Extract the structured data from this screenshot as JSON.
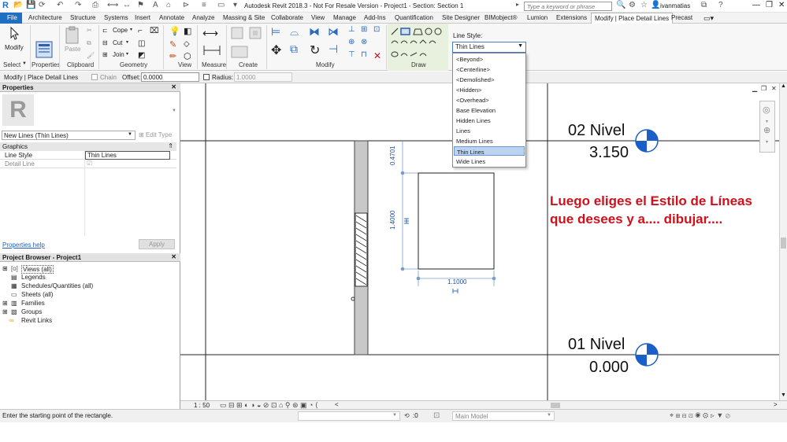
{
  "app": {
    "title": "Autodesk Revit 2018.3 - Not For Resale Version -   Project1 - Section: Section 1",
    "search_placeholder": "Type a keyword or phrase",
    "user": "ivanmatias"
  },
  "tabs": [
    "File",
    "Architecture",
    "Structure",
    "Systems",
    "Insert",
    "Annotate",
    "Analyze",
    "Massing & Site",
    "Collaborate",
    "View",
    "Manage",
    "Add-Ins",
    "Quantification",
    "Site Designer",
    "BIMobject®",
    "Lumion",
    "Extensions",
    "Modify | Place Detail Lines",
    "Precast"
  ],
  "ribbon": {
    "modify_label": "Modify",
    "select_label": "Select",
    "properties_label": "Properties",
    "paste_label": "Paste",
    "cope_label": "Cope",
    "cut_label": "Cut",
    "join_label": "Join",
    "panels": {
      "select": "Select",
      "properties": "Properties",
      "clipboard": "Clipboard",
      "geometry": "Geometry",
      "view": "View",
      "measure": "Measure",
      "create": "Create",
      "modify": "Modify",
      "draw": "Draw"
    },
    "line_style_label": "Line Style:",
    "line_style_value": "Thin Lines"
  },
  "line_style_options": [
    "<Beyond>",
    "<Centerline>",
    "<Demolished>",
    "<Hidden>",
    "<Overhead>",
    "Base Elevation",
    "Hidden Lines",
    "Lines",
    "Medium Lines",
    "Thin Lines",
    "Wide Lines"
  ],
  "selected_line_style_index": 9,
  "options_bar": {
    "context": "Modify | Place Detail Lines",
    "chain_label": "Chain",
    "offset_label": "Offset:",
    "offset_value": "0.0000",
    "radius_label": "Radius:",
    "radius_value": "1.0000"
  },
  "properties": {
    "title": "Properties",
    "type_name": "New Lines (Thin Lines)",
    "edit_type": "Edit Type",
    "group": "Graphics",
    "rows": [
      {
        "name": "Line Style",
        "value": "Thin Lines"
      },
      {
        "name": "Detail Line",
        "value": ""
      }
    ],
    "help_link": "Properties help",
    "apply": "Apply"
  },
  "project_browser": {
    "title": "Project Browser - Project1",
    "items": [
      "Views (all)",
      "Legends",
      "Schedules/Quantities (all)",
      "Sheets (all)",
      "Families",
      "Groups",
      "Revit Links"
    ]
  },
  "canvas": {
    "levels": [
      {
        "name": "02 Nivel",
        "elevation": "3.150"
      },
      {
        "name": "01 Nivel",
        "elevation": "0.000"
      }
    ],
    "dims": {
      "top": "0.4701",
      "side": "1.4000",
      "bottom": "1.1000"
    },
    "annotation_line1": "Luego eliges el Estilo de Líneas",
    "annotation_line2": "que desees y a.... dibujar...."
  },
  "view_bar": {
    "scale": "1 : 50"
  },
  "status": {
    "prompt": "Enter the starting point of the rectangle.",
    "worksets_count": ":0",
    "model": "Main Model"
  },
  "colors": {
    "file_tab": "#1f6fc2",
    "annotation": "#d0101a",
    "level_marker": "#1a5fc9",
    "draw_panel": "#e8f1dd"
  }
}
